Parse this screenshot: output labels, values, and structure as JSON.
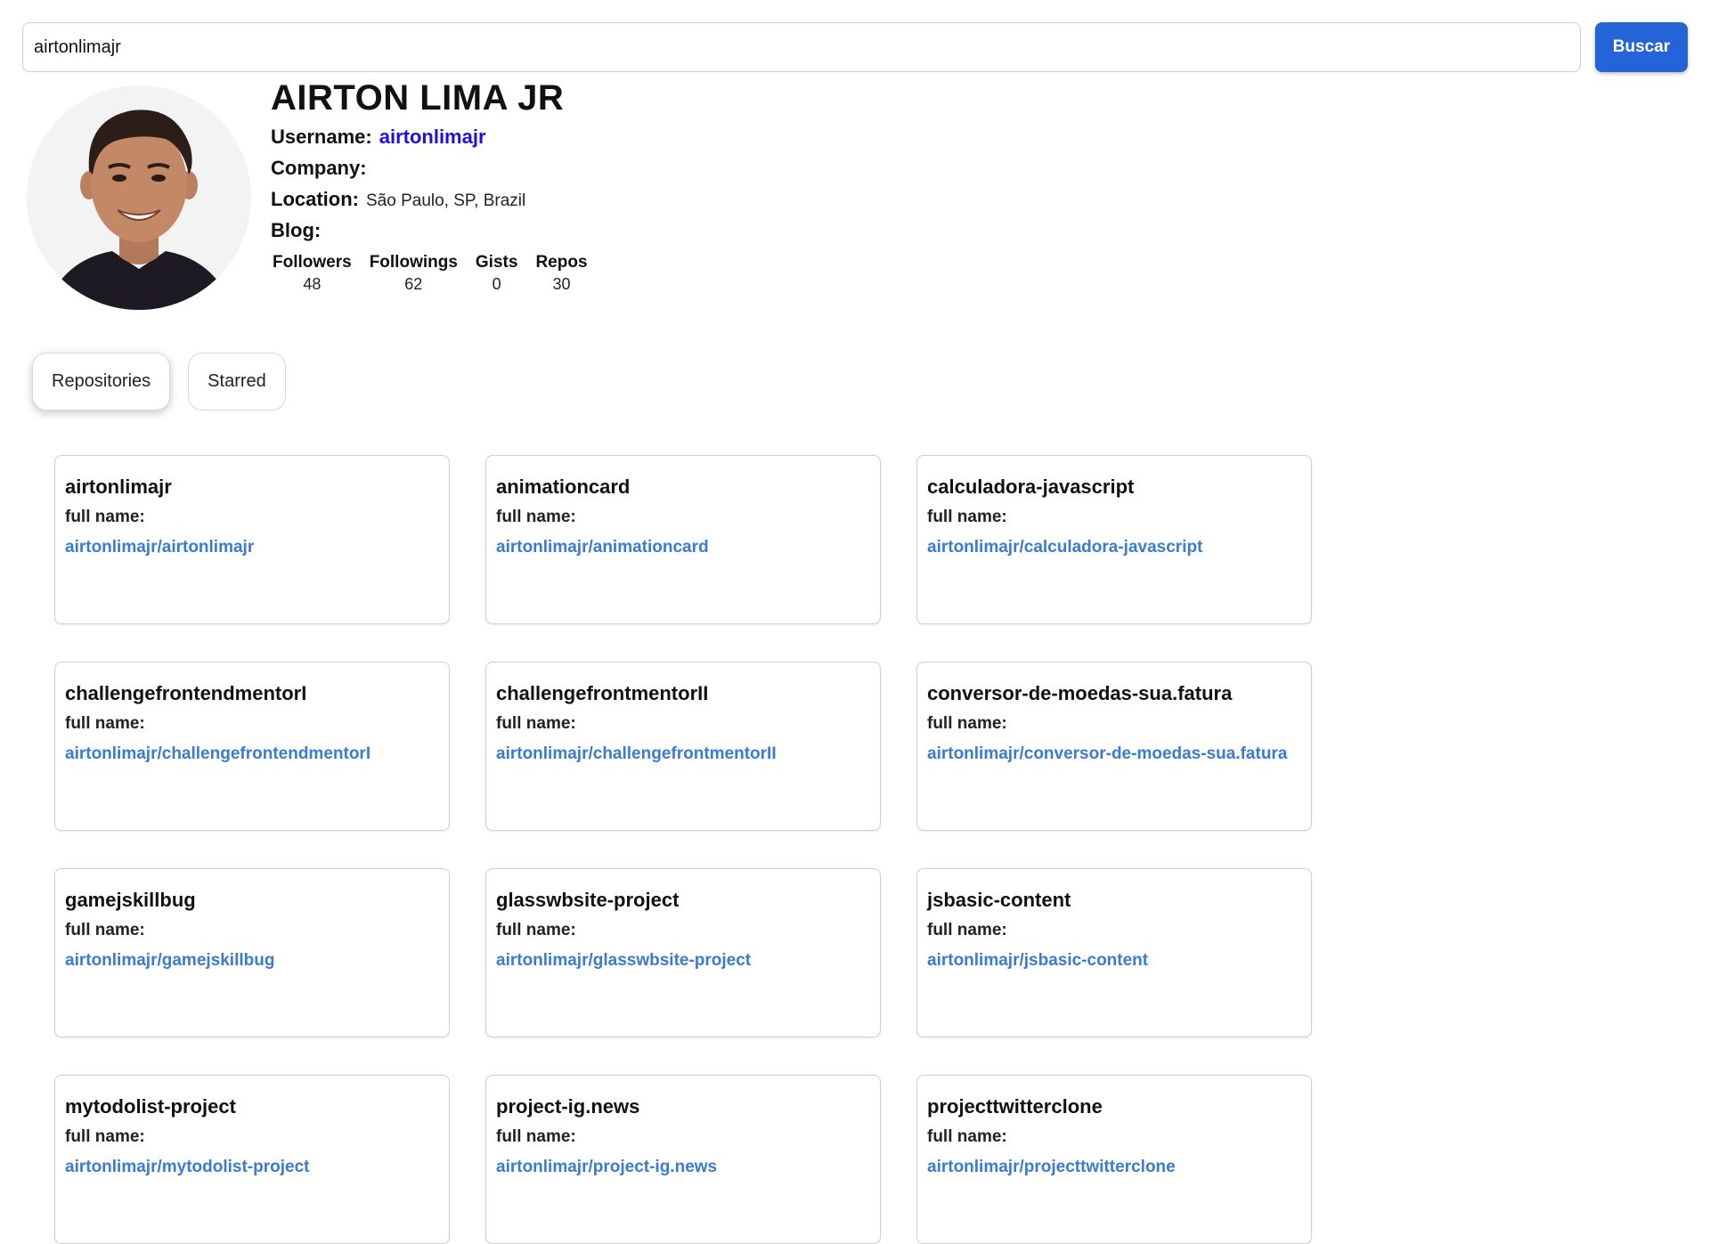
{
  "search": {
    "value": "airtonlimajr",
    "button_label": "Buscar"
  },
  "profile": {
    "name": "AIRTON LIMA JR",
    "username_label": "Username:",
    "username": "airtonlimajr",
    "company_label": "Company:",
    "company": "",
    "location_label": "Location:",
    "location": "São Paulo, SP, Brazil",
    "blog_label": "Blog:",
    "blog": ""
  },
  "stats": [
    {
      "label": "Followers",
      "value": "48"
    },
    {
      "label": "Followings",
      "value": "62"
    },
    {
      "label": "Gists",
      "value": "0"
    },
    {
      "label": "Repos",
      "value": "30"
    }
  ],
  "tabs": [
    {
      "label": "Repositories",
      "active": true
    },
    {
      "label": "Starred",
      "active": false
    }
  ],
  "repo_full_name_label": "full name:",
  "repos": [
    {
      "name": "airtonlimajr",
      "full_name": "airtonlimajr/airtonlimajr"
    },
    {
      "name": "animationcard",
      "full_name": "airtonlimajr/animationcard"
    },
    {
      "name": "calculadora-javascript",
      "full_name": "airtonlimajr/calculadora-javascript"
    },
    {
      "name": "challengefrontendmentorI",
      "full_name": "airtonlimajr/challengefrontendmentorI"
    },
    {
      "name": "challengefrontmentorII",
      "full_name": "airtonlimajr/challengefrontmentorII"
    },
    {
      "name": "conversor-de-moedas-sua.fatura",
      "full_name": "airtonlimajr/conversor-de-moedas-sua.fatura"
    },
    {
      "name": "gamejskillbug",
      "full_name": "airtonlimajr/gamejskillbug"
    },
    {
      "name": "glasswbsite-project",
      "full_name": "airtonlimajr/glasswbsite-project"
    },
    {
      "name": "jsbasic-content",
      "full_name": "airtonlimajr/jsbasic-content"
    },
    {
      "name": "mytodolist-project",
      "full_name": "airtonlimajr/mytodolist-project"
    },
    {
      "name": "project-ig.news",
      "full_name": "airtonlimajr/project-ig.news"
    },
    {
      "name": "projecttwitterclone",
      "full_name": "airtonlimajr/projecttwitterclone"
    }
  ],
  "colors": {
    "accent": "#2563d9",
    "username_link": "#1a10e6",
    "repo_link": "#3a7bd0"
  }
}
